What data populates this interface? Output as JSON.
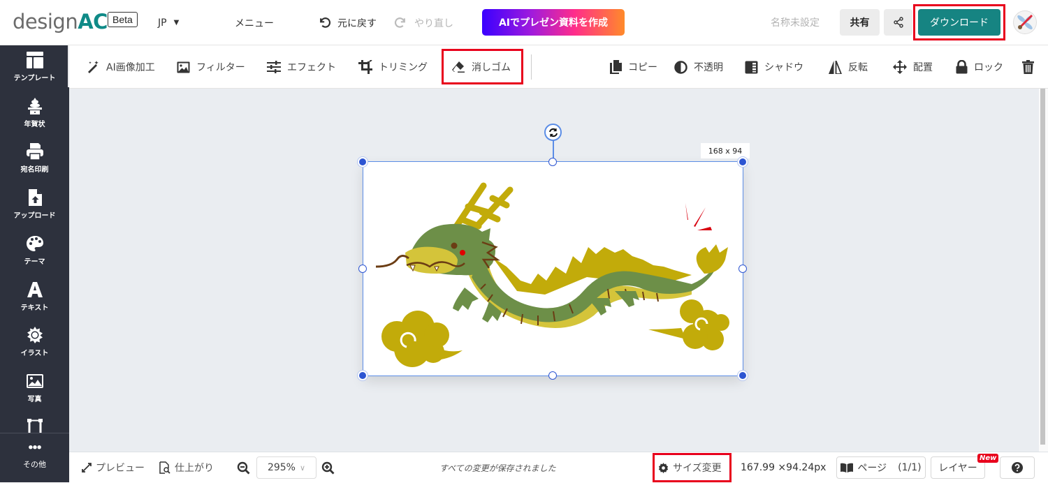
{
  "header": {
    "logo_text": "design",
    "logo_accent": "AC",
    "beta_label": "Beta",
    "language": "JP",
    "menu_label": "メニュー",
    "undo_label": "元に戻す",
    "redo_label": "やり直し",
    "ai_button_label": "AIでプレゼン資料を作成",
    "document_name": "名称未設定",
    "share_label": "共有",
    "download_label": "ダウンロード"
  },
  "sidebar": {
    "items": [
      {
        "label": "テンプレート",
        "icon": "template-icon"
      },
      {
        "label": "年賀状",
        "icon": "kagami-mochi-icon"
      },
      {
        "label": "宛名印刷",
        "icon": "printer-icon"
      },
      {
        "label": "アップロード",
        "icon": "upload-file-icon"
      },
      {
        "label": "テーマ",
        "icon": "palette-icon"
      },
      {
        "label": "テキスト",
        "icon": "text-icon"
      },
      {
        "label": "イラスト",
        "icon": "sun-icon"
      },
      {
        "label": "写真",
        "icon": "photo-icon"
      },
      {
        "label": "",
        "icon": "frame-icon"
      },
      {
        "label": "その他",
        "icon": "more-icon"
      }
    ]
  },
  "image_toolbar": {
    "left": [
      {
        "label": "AI画像加工",
        "icon": "magic-wand-icon"
      },
      {
        "label": "フィルター",
        "icon": "image-icon"
      },
      {
        "label": "エフェクト",
        "icon": "sliders-icon"
      },
      {
        "label": "トリミング",
        "icon": "crop-icon"
      },
      {
        "label": "消しゴム",
        "icon": "eraser-icon"
      }
    ],
    "right": [
      {
        "label": "コピー",
        "icon": "copy-icon"
      },
      {
        "label": "不透明",
        "icon": "opacity-icon"
      },
      {
        "label": "シャドウ",
        "icon": "shadow-icon"
      },
      {
        "label": "反転",
        "icon": "flip-icon"
      },
      {
        "label": "配置",
        "icon": "move-icon"
      },
      {
        "label": "ロック",
        "icon": "lock-icon"
      },
      {
        "label": "",
        "icon": "trash-icon"
      }
    ]
  },
  "canvas": {
    "selection_size_label": "168 x 94",
    "image_description": "Green dragon illustration with clouds"
  },
  "footer": {
    "preview_label": "プレビュー",
    "finish_label": "仕上がり",
    "zoom_value": "295%",
    "saved_status": "すべての変更が保存されました",
    "resize_label": "サイズ変更",
    "dimensions": "167.99 ×94.24px",
    "page_label": "ページ",
    "page_count": "(1/1)",
    "layer_label": "レイヤー",
    "new_badge": "New"
  },
  "colors": {
    "brand_teal": "#168482",
    "sidebar_bg": "#2d313d",
    "highlight_red": "#e8001c",
    "selection_blue": "#2d55d2"
  }
}
